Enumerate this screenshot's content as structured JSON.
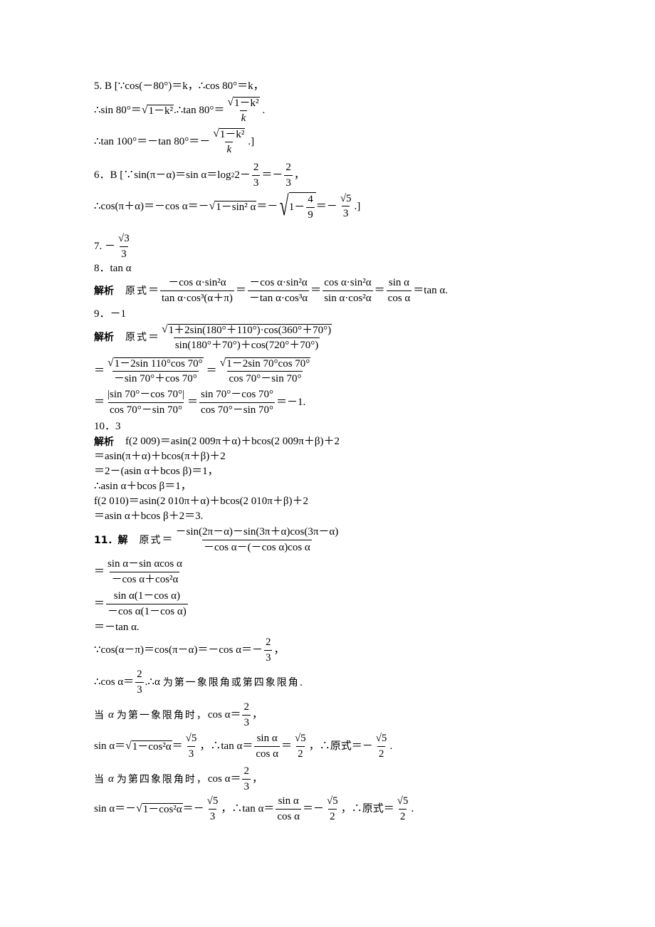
{
  "document": {
    "q5": {
      "l1": "5.  B   [∵cos(－80°)＝k，∴cos 80°＝k，",
      "l2a": "∴sin 80°＝",
      "l2_sqrt": "1－k²",
      "l2b": ".∴tan 80°＝",
      "l2_num": "1－k²",
      "l2_den": "k",
      "l2c": ".",
      "l3a": "∴tan 100°＝－tan 80°＝－",
      "l3_num": "1－k²",
      "l3_den": "k",
      "l3b": ".]"
    },
    "q6": {
      "l1a": "6．B   [∵sin(π－α)＝sin α＝log",
      "l1_sub": "2",
      "l1b": " 2－",
      "f1_num": "2",
      "f1_den": "3",
      "l1c": "＝－",
      "f2_num": "2",
      "f2_den": "3",
      "l1d": "，",
      "l2a": "∴cos(π＋α)＝－cos α＝－",
      "l2_sqrt": "1－sin² α",
      "l2b": "＝－",
      "l2_inner_a": "1－",
      "f3_num": "4",
      "f3_den": "9",
      "l2c": "＝－",
      "f4_num": "√5",
      "f4_den": "3",
      "l2d": ".]"
    },
    "q7": {
      "label": "7.  －",
      "num": "√3",
      "den": "3"
    },
    "q8": {
      "label": "8．tan α",
      "jiexi": "解析",
      "yuanshi": "原式",
      "f1_num": "－cos α·sin²α",
      "f1_den": "tan α·cos³(α＋π)",
      "f2_num": "－cos α·sin²α",
      "f2_den": "－tan α·cos³α",
      "f3_num": "cos α·sin²α",
      "f3_den": "sin α·cos²α",
      "f4_num": "sin α",
      "f4_den": "cos α",
      "result": "＝tan α."
    },
    "q9": {
      "label": "9．－1",
      "jiexi": "解析",
      "yuanshi": "原式",
      "f1_num": "1＋2sin(180°＋110°)·cos(360°＋70°)",
      "f1_den": "sin(180°＋70°)＋cos(720°＋70°)",
      "f2_num": "1－2sin 110°cos 70°",
      "f2_den": "－sin 70°＋cos 70°",
      "f3_num": "1－2sin 70°cos 70°",
      "f3_den": "cos 70°－sin 70°",
      "f4_num": "|sin 70°－cos 70°|",
      "f4_den": "cos 70°－sin 70°",
      "f5_num": "sin 70°－cos 70°",
      "f5_den": "cos 70°－sin 70°",
      "result": "＝－1."
    },
    "q10": {
      "label": "10．3",
      "jiexi": "解析",
      "lines": [
        "f(2 009)＝asin(2 009π＋α)＋bcos(2 009π＋β)＋2",
        "＝asin(π＋α)＋bcos(π＋β)＋2",
        "＝2－(asin α＋bcos β)＝1，",
        "∴asin α＋bcos β＝1，",
        "f(2 010)＝asin(2 010π＋α)＋bcos(2 010π＋β)＋2",
        "＝asin α＋bcos β＋2＝3."
      ]
    },
    "q11": {
      "label": "11．解",
      "yuanshi": "原式",
      "f1_num": "－sin(2π－α)－sin(3π＋α)cos(3π－α)",
      "f1_den": "－cos α－(－cos α)cos α",
      "f2_num": "sin α－sin αcos α",
      "f2_den": "－cos α＋cos²α",
      "f3_num": "sin α(1－cos α)",
      "f3_den": "－cos α(1－cos α)",
      "l4": "＝－tan α.",
      "l5a": "∵cos(α－π)＝cos(π－α)＝－cos α＝－",
      "l5_num": "2",
      "l5_den": "3",
      "l5b": "，",
      "l6a": "∴cos α＝",
      "l6_num": "2",
      "l6_den": "3",
      "l6b": ".∴α",
      "l6c": "为第一象限角或第四象限角.",
      "case1_a": "当",
      "case1_alpha": "α",
      "case1_b": "为第一象限角时，",
      "case1_c": "cos α＝",
      "case1_num": "2",
      "case1_den": "3",
      "case1_d": "，",
      "case1_l2a": "sin α＝",
      "case1_l2_sqrt": "1－cos²α",
      "case1_l2b": "＝",
      "case1_f1_num": "√5",
      "case1_f1_den": "3",
      "case1_l2c": "，∴tan α＝",
      "case1_f2_num": "sin α",
      "case1_f2_den": "cos α",
      "case1_l2d": "＝",
      "case1_f3_num": "√5",
      "case1_f3_den": "2",
      "case1_l2e": "，∴原式＝－",
      "case1_f4_num": "√5",
      "case1_f4_den": "2",
      "case1_l2f": ".",
      "case2_a": "当",
      "case2_alpha": "α",
      "case2_b": "为第四象限角时，",
      "case2_c": "cos α＝",
      "case2_num": "2",
      "case2_den": "3",
      "case2_d": "，",
      "case2_l2a": "sin α＝－",
      "case2_l2_sqrt": "1－cos²α",
      "case2_l2b": "＝－",
      "case2_f1_num": "√5",
      "case2_f1_den": "3",
      "case2_l2c": "，∴tan α＝",
      "case2_f2_num": "sin α",
      "case2_f2_den": "cos α",
      "case2_l2d": "＝－",
      "case2_f3_num": "√5",
      "case2_f3_den": "2",
      "case2_l2e": "，∴原式＝",
      "case2_f4_num": "√5",
      "case2_f4_den": "2",
      "case2_l2f": "."
    }
  }
}
